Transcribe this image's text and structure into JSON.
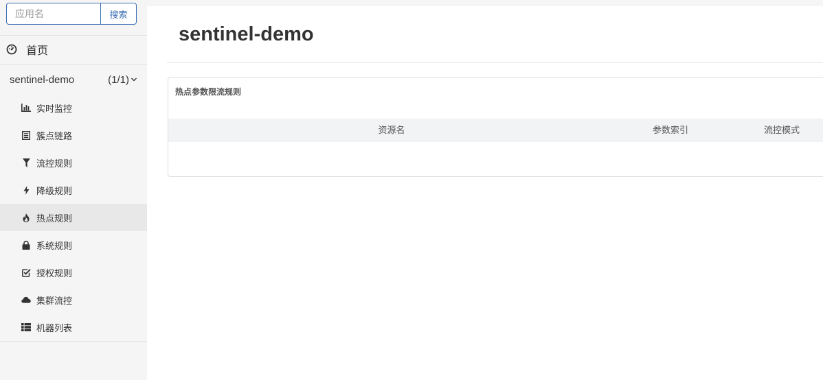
{
  "sidebar": {
    "search": {
      "placeholder": "应用名",
      "value": "",
      "button_label": "搜索"
    },
    "home_label": "首页",
    "app": {
      "name": "sentinel-demo",
      "count": "(1/1)"
    },
    "items": [
      {
        "label": "实时监控",
        "icon": "bar-chart-icon",
        "active": false
      },
      {
        "label": "簇点链路",
        "icon": "list-icon",
        "active": false
      },
      {
        "label": "流控规则",
        "icon": "filter-icon",
        "active": false
      },
      {
        "label": "降级规则",
        "icon": "flash-icon",
        "active": false
      },
      {
        "label": "热点规则",
        "icon": "fire-icon",
        "active": true
      },
      {
        "label": "系统规则",
        "icon": "lock-icon",
        "active": false
      },
      {
        "label": "授权规则",
        "icon": "check-square-icon",
        "active": false
      },
      {
        "label": "集群流控",
        "icon": "cloud-icon",
        "active": false
      },
      {
        "label": "机器列表",
        "icon": "th-list-icon",
        "active": false
      }
    ]
  },
  "main": {
    "title": "sentinel-demo",
    "panel": {
      "title": "热点参数限流规则",
      "columns": [
        "资源名",
        "参数索引",
        "流控模式"
      ],
      "rows": []
    }
  },
  "colors": {
    "accent": "#3c6eb4",
    "sidebar_bg": "#f5f5f5",
    "active_bg": "#e8e8e8",
    "table_header_bg": "#f2f3f5"
  }
}
